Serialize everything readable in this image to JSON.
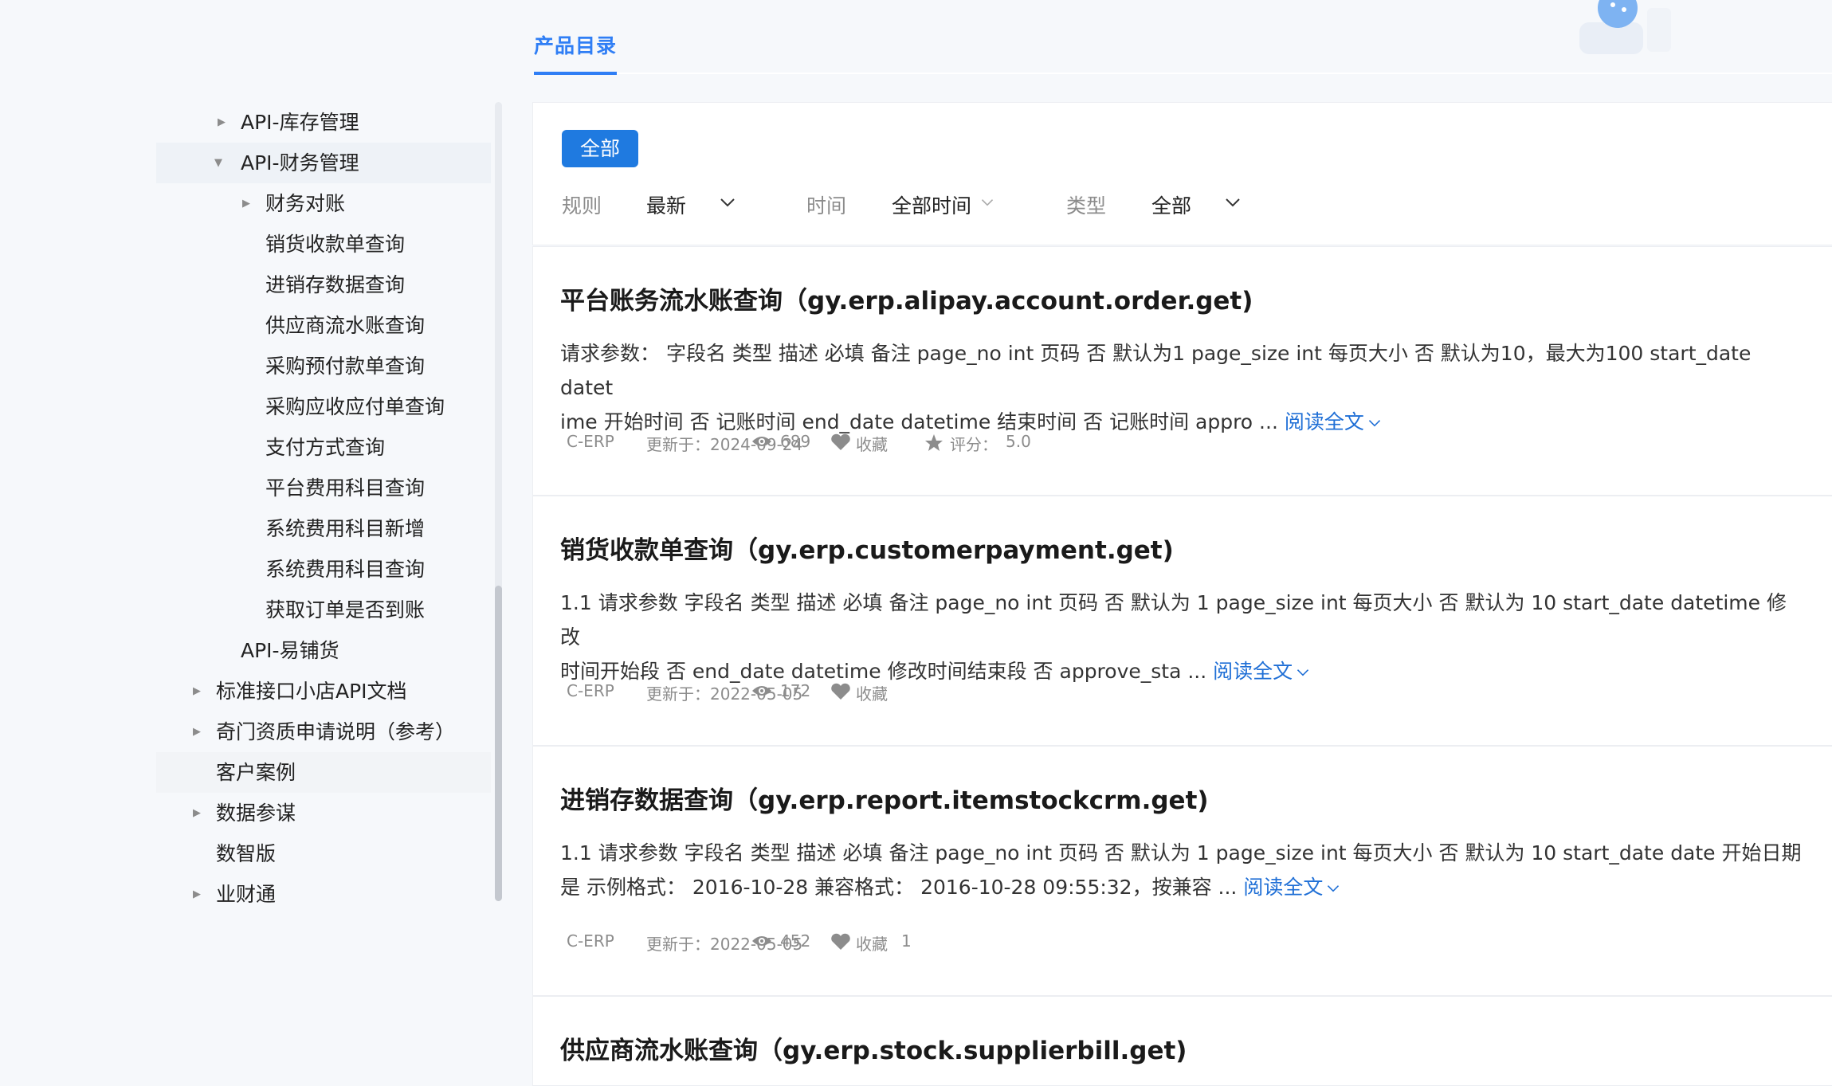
{
  "header": {
    "active_tab": "产品目录"
  },
  "tree": {
    "items": [
      {
        "label": "API-库存管理",
        "caret": "right"
      },
      {
        "label": "API-财务管理",
        "caret": "down"
      },
      {
        "label": "财务对账",
        "caret": "right"
      },
      {
        "label": "销货收款单查询"
      },
      {
        "label": "进销存数据查询"
      },
      {
        "label": "供应商流水账查询"
      },
      {
        "label": "采购预付款单查询"
      },
      {
        "label": "采购应收应付单查询"
      },
      {
        "label": "支付方式查询"
      },
      {
        "label": "平台费用科目查询"
      },
      {
        "label": "系统费用科目新增"
      },
      {
        "label": "系统费用科目查询"
      },
      {
        "label": "获取订单是否到账"
      },
      {
        "label": "API-易铺货"
      },
      {
        "label": "标准接口小店API文档",
        "caret": "right"
      },
      {
        "label": "奇门资质申请说明（参考）",
        "caret": "right"
      },
      {
        "label": "客户案例"
      },
      {
        "label": "数据参谋",
        "caret": "right"
      },
      {
        "label": "数智版"
      },
      {
        "label": "业财通",
        "caret": "right"
      }
    ]
  },
  "filters": {
    "all_button": "全部",
    "rule_label": "规则",
    "rule_value": "最新",
    "time_label": "时间",
    "time_value": "全部时间",
    "type_label": "类型",
    "type_value": "全部"
  },
  "articles": [
    {
      "title": "平台账务流水账查询（gy.erp.alipay.account.order.get)",
      "desc_line1": "请求参数： 字段名 类型 描述 必填 备注 page_no int 页码 否 默认为1 page_size int 每页大小 否 默认为10，最大为100 start_date datet",
      "desc_line2": "ime 开始时间 否 记账时间 end_date datetime 结束时间 否 记账时间 appro ...",
      "read_more": "阅读全文",
      "source": "C-ERP",
      "updated": "更新于：2024-09-24",
      "views": "689",
      "fav_label": "收藏",
      "fav_count": "",
      "rating_label": "评分：",
      "rating": "5.0"
    },
    {
      "title": "销货收款单查询（gy.erp.customerpayment.get)",
      "desc_line1": "1.1 请求参数 字段名 类型 描述 必填 备注 page_no int 页码 否 默认为 1 page_size int 每页大小 否 默认为 10 start_date datetime 修改",
      "desc_line2": "时间开始段 否 end_date datetime 修改时间结束段 否 approve_sta ...",
      "read_more": "阅读全文",
      "source": "C-ERP",
      "updated": "更新于：2022-05-05",
      "views": "172",
      "fav_label": "收藏",
      "fav_count": ""
    },
    {
      "title": "进销存数据查询（gy.erp.report.itemstockcrm.get)",
      "desc_line1": "1.1 请求参数 字段名 类型 描述 必填 备注 page_no int 页码 否 默认为 1 page_size int 每页大小 否 默认为 10 start_date date 开始日期",
      "desc_line2": "是 示例格式： 2016-10-28 兼容格式： 2016-10-28 09:55:32，按兼容 ...",
      "read_more": "阅读全文",
      "source": "C-ERP",
      "updated": "更新于：2022-05-05",
      "views": "452",
      "fav_label": "收藏",
      "fav_count": "1"
    },
    {
      "title": "供应商流水账查询（gy.erp.stock.supplierbill.get)"
    }
  ],
  "icons": {
    "eye": "eye-icon",
    "heart": "heart-icon",
    "star": "star-icon",
    "caret_right": "caret-right-icon",
    "caret_down": "caret-down-icon",
    "chevron": "chevron-down-icon"
  },
  "colors": {
    "accent": "#1f7ae0",
    "link": "#1f6fd6",
    "muted": "#8c8c8c",
    "tab": "#2f7ef5"
  }
}
